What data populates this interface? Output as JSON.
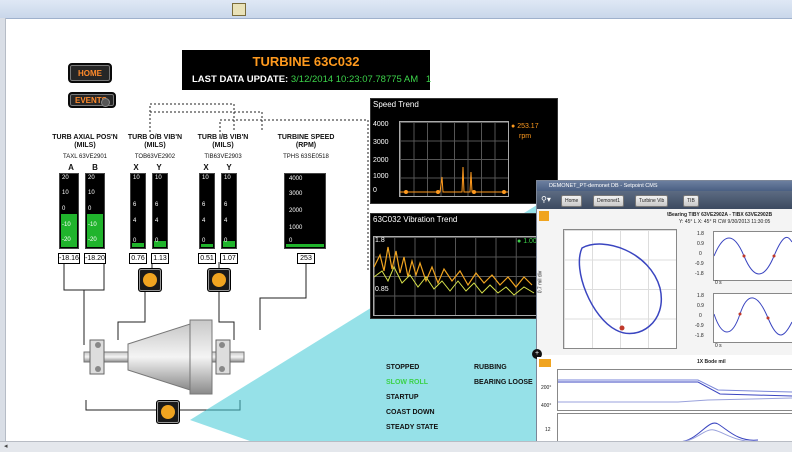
{
  "colors": {
    "accent_orange": "#ff9a1e",
    "green": "#20b42c",
    "update_green": "#3cd24a",
    "teal": "#3fc8d6"
  },
  "buttons": {
    "home": "HOME",
    "events": "EVENTS"
  },
  "header": {
    "title": "TURBINE 63C032",
    "update_label": "LAST DATA UPDATE:",
    "update_value": "3/12/2014 10:23:07.78775 AM",
    "update_count": "1"
  },
  "gauges": {
    "axial": {
      "title": "TURB AXIAL POS'N",
      "unit": "(MILS)",
      "tag": "TAXL 63VE2901",
      "ch_a": "A",
      "ch_b": "B",
      "ticks": [
        "20",
        "10",
        "0",
        "-10",
        "-20"
      ],
      "val_a": "-18.16",
      "val_b": "-18.20"
    },
    "ob_vib": {
      "title": "TURB O/B VIB'N",
      "unit": "(MILS)",
      "tag": "TOB63VE2902",
      "ch_x": "X",
      "ch_y": "Y",
      "ticks": [
        "10",
        "6",
        "4",
        "0"
      ],
      "val_x": "0.76",
      "val_y": "1.13"
    },
    "ib_vib": {
      "title": "TURB I/B VIB'N",
      "unit": "(MILS)",
      "tag": "TIB63VE2903",
      "ch_x": "X",
      "ch_y": "Y",
      "ticks": [
        "10",
        "6",
        "4",
        "0"
      ],
      "val_x": "0.51",
      "val_y": "1.07"
    },
    "speed": {
      "title": "TURBINE SPEED",
      "unit": "(RPM)",
      "tag": "TPHS 63SE0518",
      "ticks": [
        "4000",
        "3000",
        "2000",
        "1000",
        "0"
      ],
      "value": "253"
    }
  },
  "speed_trend": {
    "title": "Speed Trend",
    "yticks": [
      "4000",
      "3000",
      "2000",
      "1000",
      "0"
    ],
    "current": "253.17",
    "unit": "rpm"
  },
  "vib_trend": {
    "title": "63C032 Vibration Trend",
    "yticks": [
      "1.8",
      "0.85"
    ],
    "current": "1.00"
  },
  "states": {
    "col1": [
      "STOPPED",
      "SLOW ROLL",
      "STARTUP",
      "COAST DOWN",
      "STEADY STATE"
    ],
    "col2": [
      "RUBBING",
      "BEARING LOOSE"
    ]
  },
  "cms": {
    "window_title": "DEMONET_PT-demonet DB - Setpoint CMS",
    "crumbs": [
      "Home",
      "Demonet1",
      "Turbine Vib",
      "TIB"
    ],
    "orbit_title": "\\Bearing TIBY 63VE2902A - TIBX 63VE2902B",
    "orbit_sub": "Y: 45° L  X: 45° R  CW  9/30/2013 11:30:05",
    "orbit_ylabel": "0.7 mil div",
    "y_ticks": [
      "1.8",
      "0.9",
      "0",
      "-0.9",
      "-1.8"
    ],
    "x_axis": "0 s",
    "bode_title": "1X Bode mil",
    "bode_ticks": [
      "200°",
      "400°"
    ],
    "lower_tick": "12"
  }
}
